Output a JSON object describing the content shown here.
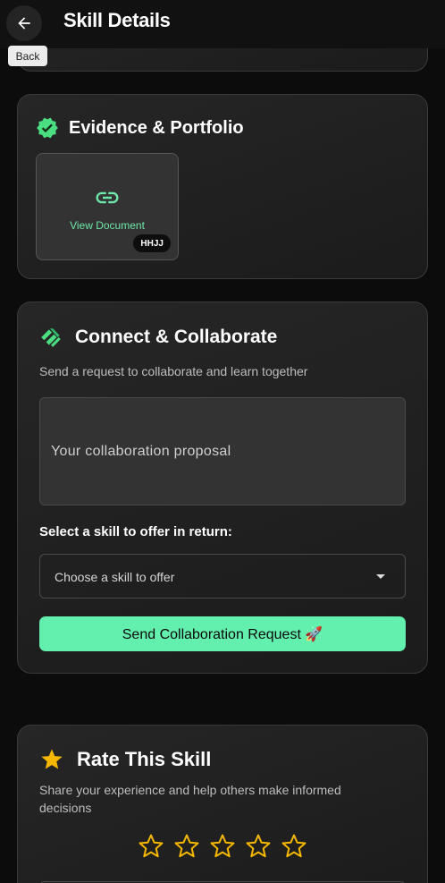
{
  "appbar": {
    "title": "Skill Details",
    "back_tooltip": "Back",
    "back_icon": "arrow-left-icon"
  },
  "evidence": {
    "title": "Evidence & Portfolio",
    "title_icon": "verified-badge-icon",
    "document": {
      "label": "View Document",
      "badge": "HHJJ",
      "icon": "link-icon"
    }
  },
  "connect": {
    "title": "Connect & Collaborate",
    "title_icon": "handshake-icon",
    "subtitle": "Send a request to collaborate and learn together",
    "proposal_placeholder": "Your collaboration proposal",
    "select_label": "Select a skill to offer in return:",
    "select_placeholder": "Choose a skill to offer",
    "send_button": "Send Collaboration Request 🚀"
  },
  "rate": {
    "title": "Rate This Skill",
    "title_icon": "star-icon",
    "subtitle": "Share your experience and help others make informed decisions",
    "rating": 0,
    "max_rating": 5
  },
  "colors": {
    "accent": "#63efad",
    "star": "#f5b700",
    "background": "#0c0c0c",
    "card": "#232323"
  }
}
